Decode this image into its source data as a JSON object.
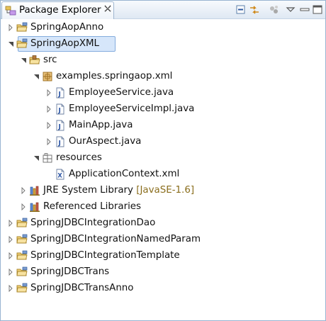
{
  "view": {
    "title": "Package Explorer",
    "toolbar": [
      "collapse-all-icon",
      "link-with-editor-icon",
      "focus-on-active-task-icon",
      "view-menu-icon",
      "minimize-icon",
      "maximize-icon"
    ]
  },
  "tree": {
    "rows": [
      {
        "label": "SpringAopAnno",
        "icon": "project-icon",
        "expanded": false
      },
      {
        "label": "SpringAopXML",
        "icon": "project-icon",
        "expanded": true,
        "selected": true
      },
      {
        "label": "src",
        "icon": "source-folder-icon",
        "expanded": true
      },
      {
        "label": "examples.springaop.xml",
        "icon": "package-icon",
        "expanded": true
      },
      {
        "label": "EmployeeService.java",
        "icon": "java-file-icon",
        "expanded": false
      },
      {
        "label": "EmployeeServiceImpl.java",
        "icon": "java-file-icon",
        "expanded": false
      },
      {
        "label": "MainApp.java",
        "icon": "java-file-icon",
        "expanded": false
      },
      {
        "label": "OurAspect.java",
        "icon": "java-file-icon",
        "expanded": false
      },
      {
        "label": "resources",
        "icon": "default-package-icon",
        "expanded": true
      },
      {
        "label": "ApplicationContext.xml",
        "icon": "xml-file-icon"
      },
      {
        "label": "JRE System Library",
        "decoration": "[JavaSE-1.6]",
        "icon": "library-icon",
        "expanded": false
      },
      {
        "label": "Referenced Libraries",
        "icon": "library-icon",
        "expanded": false
      },
      {
        "label": "SpringJDBCIntegrationDao",
        "icon": "project-icon",
        "expanded": false
      },
      {
        "label": "SpringJDBCIntegrationNamedParam",
        "icon": "project-icon",
        "expanded": false
      },
      {
        "label": "SpringJDBCIntegrationTemplate",
        "icon": "project-icon",
        "expanded": false
      },
      {
        "label": "SpringJDBCTrans",
        "icon": "project-icon",
        "expanded": false
      },
      {
        "label": "SpringJDBCTransAnno",
        "icon": "project-icon",
        "expanded": false
      }
    ]
  }
}
